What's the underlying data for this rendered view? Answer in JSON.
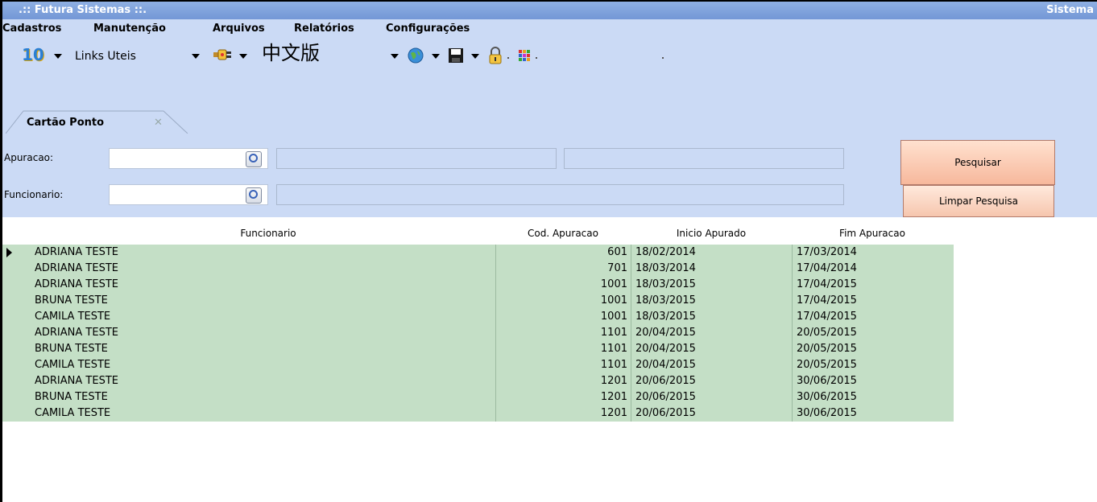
{
  "window": {
    "title": ".:: Futura Sistemas ::.",
    "title_right": "Sistema"
  },
  "menu": [
    "Cadastros",
    "Manutenção",
    "Arquivos",
    "Relatórios",
    "Configurações"
  ],
  "toolbar": {
    "version_icon_label": "10",
    "links_label": "Links Uteis",
    "chinese_label": "中文版"
  },
  "tab": {
    "label": "Cartão Ponto",
    "close": "✕"
  },
  "filters": {
    "apuracao_label": "Apuracao:",
    "funcionario_label": "Funcionario:",
    "search_button": "Pesquisar",
    "clear_button": "Limpar Pesquisa"
  },
  "grid": {
    "columns": [
      "Funcionario",
      "Cod. Apuracao",
      "Inicio Apurado",
      "Fim Apuracao"
    ],
    "rows": [
      [
        "ADRIANA TESTE",
        "601",
        "18/02/2014",
        "17/03/2014"
      ],
      [
        "ADRIANA TESTE",
        "701",
        "18/03/2014",
        "17/04/2014"
      ],
      [
        "ADRIANA TESTE",
        "1001",
        "18/03/2015",
        "17/04/2015"
      ],
      [
        "BRUNA TESTE",
        "1001",
        "18/03/2015",
        "17/04/2015"
      ],
      [
        "CAMILA TESTE",
        "1001",
        "18/03/2015",
        "17/04/2015"
      ],
      [
        "ADRIANA TESTE",
        "1101",
        "20/04/2015",
        "20/05/2015"
      ],
      [
        "BRUNA TESTE",
        "1101",
        "20/04/2015",
        "20/05/2015"
      ],
      [
        "CAMILA TESTE",
        "1101",
        "20/04/2015",
        "20/05/2015"
      ],
      [
        "ADRIANA TESTE",
        "1201",
        "20/06/2015",
        "30/06/2015"
      ],
      [
        "BRUNA TESTE",
        "1201",
        "20/06/2015",
        "30/06/2015"
      ],
      [
        "CAMILA TESTE",
        "1201",
        "20/06/2015",
        "30/06/2015"
      ]
    ],
    "selected_row": 0
  },
  "colors": {
    "panel": "#cbdaf5",
    "row": "#c4dfc6",
    "title_bar": "#7f9fd9",
    "button": "#f7b89c"
  }
}
